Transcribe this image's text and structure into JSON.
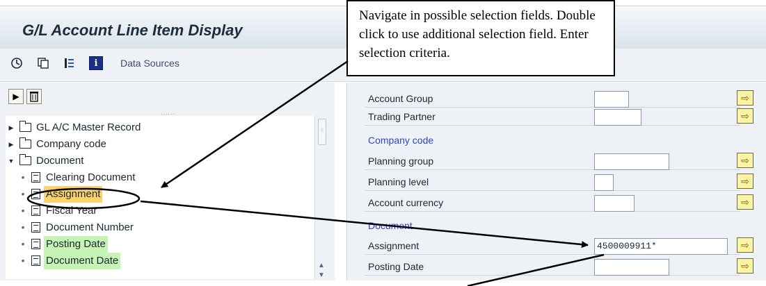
{
  "window": {
    "title": "G/L Account Line Item Display"
  },
  "toolbar": {
    "icons": [
      "execute-icon",
      "copy-icon",
      "selection-options-icon",
      "info-icon"
    ],
    "info_glyph": "i",
    "data_sources_label": "Data Sources"
  },
  "tree_buttons": [
    "expand-icon",
    "delete-icon"
  ],
  "tree": {
    "items": [
      {
        "label": "GL A/C Master Record",
        "type": "folder",
        "expanded": false,
        "highlight": ""
      },
      {
        "label": "Company code",
        "type": "folder",
        "expanded": false,
        "highlight": ""
      },
      {
        "label": "Document",
        "type": "folder",
        "expanded": true,
        "highlight": ""
      },
      {
        "label": "Clearing Document",
        "type": "field",
        "highlight": ""
      },
      {
        "label": "Assignment",
        "type": "field",
        "highlight": "orange"
      },
      {
        "label": "Fiscal Year",
        "type": "field",
        "highlight": ""
      },
      {
        "label": "Document Number",
        "type": "field",
        "highlight": ""
      },
      {
        "label": "Posting Date",
        "type": "field",
        "highlight": "green"
      },
      {
        "label": "Document Date",
        "type": "field",
        "highlight": "green"
      }
    ]
  },
  "fields": {
    "account_group": {
      "label": "Account Group",
      "value": ""
    },
    "trading_partner": {
      "label": "Trading Partner",
      "value": ""
    },
    "section_company_code": "Company code",
    "planning_group": {
      "label": "Planning group",
      "value": ""
    },
    "planning_level": {
      "label": "Planning level",
      "value": ""
    },
    "account_currency": {
      "label": "Account currency",
      "value": ""
    },
    "section_document": "Document",
    "assignment": {
      "label": "Assignment",
      "value": "4500009911*"
    },
    "posting_date": {
      "label": "Posting Date",
      "value": ""
    }
  },
  "callout": {
    "text": "Navigate in possible selection fields. Double click to use additional selection field. Enter selection criteria."
  },
  "colors": {
    "highlight_orange": "#fcd26a",
    "highlight_green": "#c5f4b4",
    "section_blue": "#2f45c8",
    "button_yellow": "#fbf3a6"
  }
}
